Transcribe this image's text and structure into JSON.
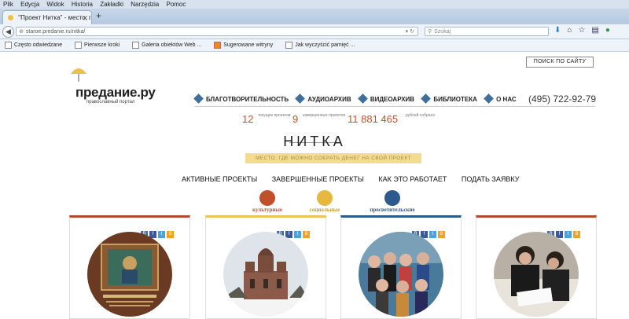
{
  "browser": {
    "menu": [
      "Plik",
      "Edycja",
      "Widok",
      "Historia",
      "Zakładki",
      "Narzędzia",
      "Pomoc"
    ],
    "tab_title": "\"Проект Нитка\" - место, г...",
    "url": "starое.predanie.ru/nitka/",
    "search_placeholder": "Szukaj",
    "bookmarks": [
      "Często odwiedzane",
      "Pierwsze kroki",
      "Galeria obiektów Web ...",
      "Sugerowane witryny",
      "Jak wyczyścić pamięć ..."
    ]
  },
  "site": {
    "search_button": "ПОИСК ПО САЙТУ",
    "logo": "предание.ру",
    "logo_sub": "православный портал",
    "nav": [
      "БЛАГОТВОРИТЕЛЬНОСТЬ",
      "АУДИОАРХИВ",
      "ВИДЕОАРХИВ",
      "БИБЛИОТЕКА",
      "О НАС"
    ],
    "phone": "(495) 722-92-79"
  },
  "stats": [
    {
      "value": "12",
      "label": "текущих проектов"
    },
    {
      "value": "9",
      "label": "завершенных проектов"
    },
    {
      "value": "11 881 465",
      "label": "рублей собрано"
    }
  ],
  "project": {
    "title": "НИТКА",
    "tagline": "МЕСТО, ГДЕ МОЖНО СОБРАТЬ ДЕНЕГ НА СВОЙ ПРОЕКТ",
    "menu": [
      "АКТИВНЫЕ ПРОЕКТЫ",
      "ЗАВЕРШЕННЫЕ ПРОЕКТЫ",
      "КАК ЭТО РАБОТАЕТ",
      "ПОДАТЬ ЗАЯВКУ"
    ]
  },
  "categories": [
    {
      "label": "культурные",
      "color": "#c0502c"
    },
    {
      "label": "социальные",
      "color": "#e6b840"
    },
    {
      "label": "просветительские",
      "color": "#2d5a8c"
    }
  ],
  "cards": [
    {
      "color": "#b14a2e",
      "photo": "icon-book-cover"
    },
    {
      "color": "#e8c45a",
      "photo": "ruined-church-photo"
    },
    {
      "color": "#2d5a8c",
      "photo": "group-photo"
    },
    {
      "color": "#b14a2e",
      "photo": "monks-reading-photo"
    }
  ],
  "social": [
    "В",
    "f",
    "t",
    "8"
  ]
}
